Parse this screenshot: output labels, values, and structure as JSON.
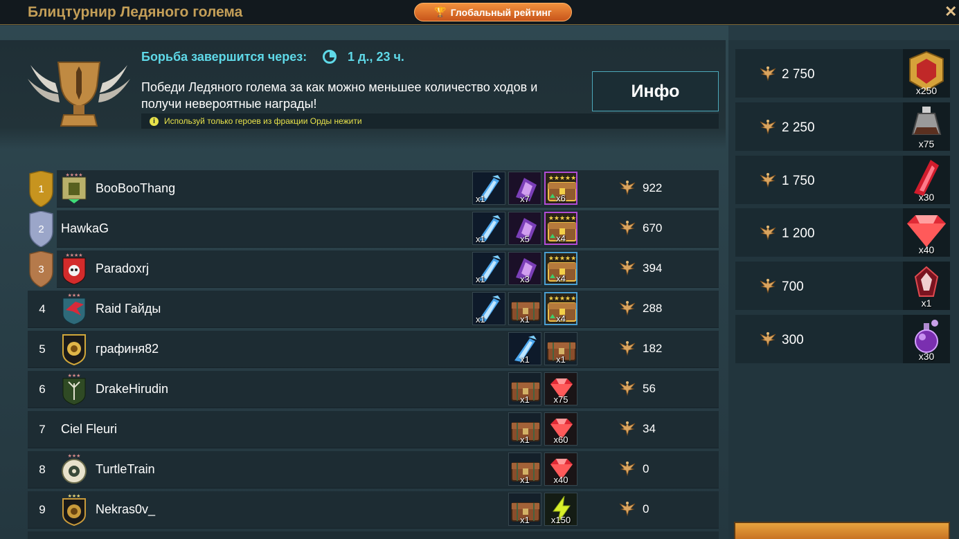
{
  "window": {
    "title": "Блицтурнир Ледяного голема",
    "global_rating_label": "Глобальный рейтинг",
    "close_label": "✕"
  },
  "header": {
    "timer_label": "Борьба завершится через:",
    "timer_value": "1 д., 23 ч.",
    "description": "Победи Ледяного голема за как можно меньшее количество ходов и получи невероятные награды!",
    "info_button": "Инфо",
    "notice": "Используй только героев из фракции Орды нежити"
  },
  "leaderboard": [
    {
      "rank": "1",
      "name": "BooBooThang",
      "points": "922",
      "rewards": [
        "x1",
        "x7",
        "x6"
      ]
    },
    {
      "rank": "2",
      "name": "HawkaG",
      "points": "670",
      "rewards": [
        "x1",
        "x5",
        "x4"
      ]
    },
    {
      "rank": "3",
      "name": "Paradoxrj",
      "points": "394",
      "rewards": [
        "x1",
        "x3",
        "x4"
      ]
    },
    {
      "rank": "4",
      "name": "Raid Гайды",
      "points": "288",
      "rewards": [
        "x1",
        "x1",
        "x4"
      ]
    },
    {
      "rank": "5",
      "name": "графиня82",
      "points": "182",
      "rewards": [
        "x1",
        "x1"
      ]
    },
    {
      "rank": "6",
      "name": "DrakeHirudin",
      "points": "56",
      "rewards": [
        "x1",
        "x75"
      ]
    },
    {
      "rank": "7",
      "name": "Ciel Fleuri",
      "points": "34",
      "rewards": [
        "x1",
        "x60"
      ]
    },
    {
      "rank": "8",
      "name": "TurtleTrain",
      "points": "0",
      "rewards": [
        "x1",
        "x40"
      ]
    },
    {
      "rank": "9",
      "name": "Nekras0v_",
      "points": "0",
      "rewards": [
        "x1",
        "x150"
      ]
    }
  ],
  "point_rewards": [
    {
      "points": "2 750",
      "qty": "x250"
    },
    {
      "points": "2 250",
      "qty": "x75"
    },
    {
      "points": "1 750",
      "qty": "x30"
    },
    {
      "points": "1 200",
      "qty": "x40"
    },
    {
      "points": "700",
      "qty": "x1"
    },
    {
      "points": "300",
      "qty": "x30"
    }
  ],
  "colors": {
    "accent_gold": "#c49f58",
    "timer_cyan": "#5fd9e8",
    "notice_yellow": "#e8e24b",
    "epic_border": "#b04cd6",
    "rare_border": "#4a9ed0"
  }
}
